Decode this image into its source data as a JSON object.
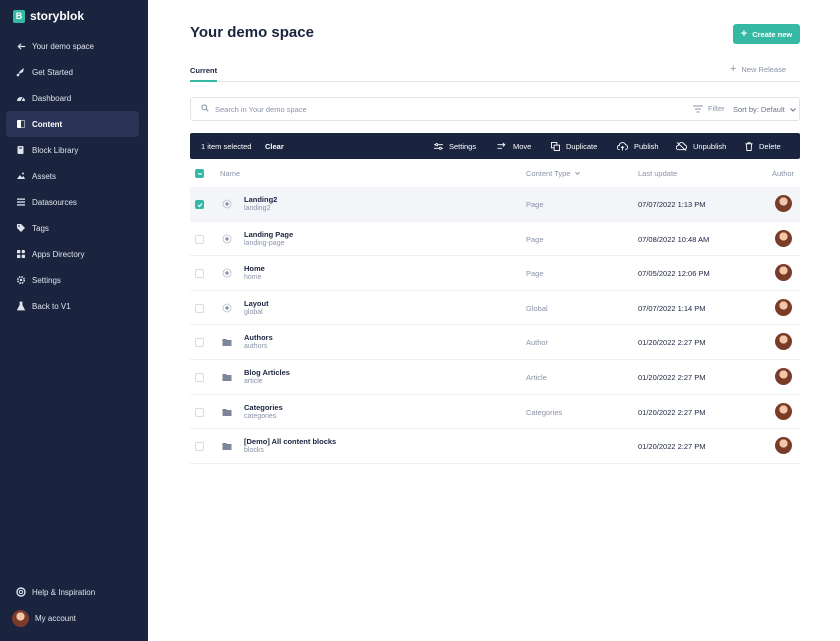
{
  "app": {
    "logo_letter": "B",
    "logo_text": "storyblok"
  },
  "sidebar": {
    "items": [
      {
        "label": "Your demo space",
        "icon": "arrow-left-icon"
      },
      {
        "label": "Get Started",
        "icon": "rocket-icon"
      },
      {
        "label": "Dashboard",
        "icon": "dashboard-icon"
      },
      {
        "label": "Content",
        "icon": "content-icon",
        "active": true
      },
      {
        "label": "Block Library",
        "icon": "blocks-icon"
      },
      {
        "label": "Assets",
        "icon": "assets-icon"
      },
      {
        "label": "Datasources",
        "icon": "datasources-icon"
      },
      {
        "label": "Tags",
        "icon": "tag-icon"
      },
      {
        "label": "Apps Directory",
        "icon": "apps-icon"
      },
      {
        "label": "Settings",
        "icon": "gear-icon"
      },
      {
        "label": "Back to V1",
        "icon": "flask-icon"
      }
    ],
    "help_label": "Help & Inspiration",
    "account_label": "My account"
  },
  "header": {
    "title": "Your demo space",
    "create_label": "Create new"
  },
  "tabs": {
    "current": "Current",
    "new_release": "New Release"
  },
  "search": {
    "placeholder": "Search in Your demo space",
    "filter_label": "Filter",
    "sort_label": "Sort by: Default"
  },
  "actionbar": {
    "selected_count": "1 item selected",
    "clear": "Clear",
    "settings": "Settings",
    "move": "Move",
    "duplicate": "Duplicate",
    "publish": "Publish",
    "unpublish": "Unpublish",
    "delete": "Delete"
  },
  "table": {
    "columns": {
      "name": "Name",
      "content_type": "Content Type",
      "last_update": "Last update",
      "author": "Author"
    },
    "rows": [
      {
        "name": "Landing2",
        "slug": "landing2",
        "content_type": "Page",
        "last_update": "07/07/2022 1:13 PM",
        "kind": "story",
        "selected": true
      },
      {
        "name": "Landing Page",
        "slug": "landing-page",
        "content_type": "Page",
        "last_update": "07/08/2022 10:48 AM",
        "kind": "story",
        "selected": false
      },
      {
        "name": "Home",
        "slug": "home",
        "content_type": "Page",
        "last_update": "07/05/2022 12:06 PM",
        "kind": "story",
        "selected": false
      },
      {
        "name": "Layout",
        "slug": "global",
        "content_type": "Global",
        "last_update": "07/07/2022 1:14 PM",
        "kind": "story",
        "selected": false
      },
      {
        "name": "Authors",
        "slug": "authors",
        "content_type": "Author",
        "last_update": "01/20/2022 2:27 PM",
        "kind": "folder",
        "selected": false
      },
      {
        "name": "Blog Articles",
        "slug": "article",
        "content_type": "Article",
        "last_update": "01/20/2022 2:27 PM",
        "kind": "folder",
        "selected": false
      },
      {
        "name": "Categories",
        "slug": "categories",
        "content_type": "Categories",
        "last_update": "01/20/2022 2:27 PM",
        "kind": "folder",
        "selected": false
      },
      {
        "name": "[Demo] All content blocks",
        "slug": "blocks",
        "content_type": "",
        "last_update": "01/20/2022 2:27 PM",
        "kind": "folder",
        "selected": false
      }
    ]
  },
  "colors": {
    "sidebar_bg": "#1b243f",
    "accent": "#36b9a4",
    "muted": "#8a93a8"
  }
}
